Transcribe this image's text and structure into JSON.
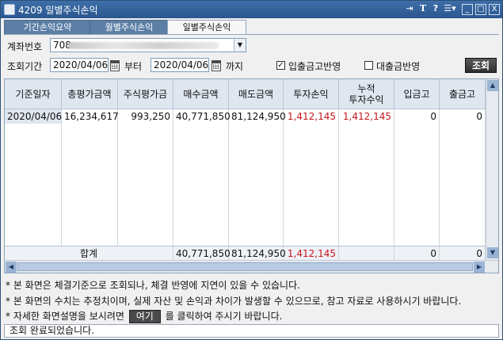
{
  "window": {
    "title": "4209 일별주식손익"
  },
  "titlebar_buttons": {
    "text": "T",
    "help": "?",
    "min": "_",
    "max": "□",
    "close": "X"
  },
  "tabs": [
    {
      "label": "기간손익요약"
    },
    {
      "label": "월별주식손익"
    },
    {
      "label": "일별주식손익"
    }
  ],
  "form": {
    "account_label": "계좌번호",
    "account_value": "708",
    "period_label": "조회기간",
    "start_date": "2020/04/06",
    "from_label": "부터",
    "end_date": "2020/04/06",
    "to_label": "까지",
    "deposit_check_label": "입출금고반영",
    "deposit_checked": true,
    "loan_check_label": "대출금반영",
    "loan_checked": false,
    "search_button": "조회"
  },
  "table": {
    "headers": [
      "기준일자",
      "총평가금액",
      "주식평가금",
      "매수금액",
      "매도금액",
      "투자손익",
      "누적\n투자수익",
      "입금고",
      "출금고"
    ],
    "row": [
      "2020/04/06",
      "16,234,617",
      "993,250",
      "40,771,850",
      "81,124,950",
      "1,412,145",
      "1,412,145",
      "0",
      "0"
    ],
    "sum_label": "합계",
    "sum": [
      "40,771,850",
      "81,124,950",
      "1,412,145",
      "0",
      "0"
    ]
  },
  "notes": {
    "line1": "* 본 화면은 체결기준으로 조회되나, 체결 반영에 지연이 있을 수 있습니다.",
    "line2": "* 본 화면의 수치는 추정치이며, 실제 자산 및 손익과 차이가 발생할 수 있으므로, 참고 자료로 사용하시기 바랍니다.",
    "line3_prefix": "* 자세한 화면설명을 보시려면",
    "here_button": "여기",
    "line3_suffix": "를 클릭하여 주시기 바랍니다."
  },
  "status": {
    "text": "조회 완료되었습니다."
  },
  "colors": {
    "titlebar": "#2a568e",
    "tab_inactive": "#5d7fa6",
    "profit_red": "#c4161c",
    "header_bg": "#dfe6f0"
  }
}
